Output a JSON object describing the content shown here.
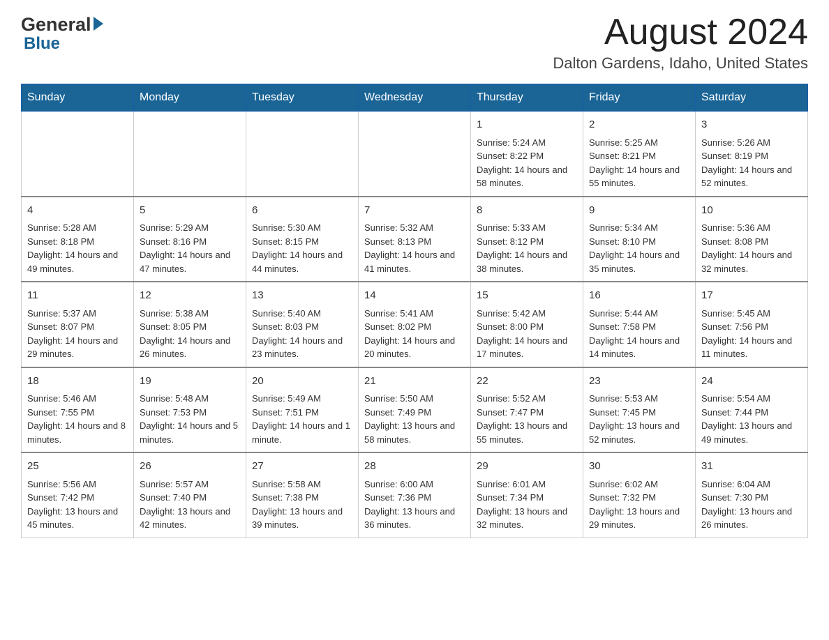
{
  "header": {
    "logo_general": "General",
    "logo_blue": "Blue",
    "month_year": "August 2024",
    "location": "Dalton Gardens, Idaho, United States"
  },
  "days_of_week": [
    "Sunday",
    "Monday",
    "Tuesday",
    "Wednesday",
    "Thursday",
    "Friday",
    "Saturday"
  ],
  "weeks": [
    {
      "cells": [
        {
          "day": "",
          "sunrise": "",
          "sunset": "",
          "daylight": ""
        },
        {
          "day": "",
          "sunrise": "",
          "sunset": "",
          "daylight": ""
        },
        {
          "day": "",
          "sunrise": "",
          "sunset": "",
          "daylight": ""
        },
        {
          "day": "",
          "sunrise": "",
          "sunset": "",
          "daylight": ""
        },
        {
          "day": "1",
          "sunrise": "Sunrise: 5:24 AM",
          "sunset": "Sunset: 8:22 PM",
          "daylight": "Daylight: 14 hours and 58 minutes."
        },
        {
          "day": "2",
          "sunrise": "Sunrise: 5:25 AM",
          "sunset": "Sunset: 8:21 PM",
          "daylight": "Daylight: 14 hours and 55 minutes."
        },
        {
          "day": "3",
          "sunrise": "Sunrise: 5:26 AM",
          "sunset": "Sunset: 8:19 PM",
          "daylight": "Daylight: 14 hours and 52 minutes."
        }
      ]
    },
    {
      "cells": [
        {
          "day": "4",
          "sunrise": "Sunrise: 5:28 AM",
          "sunset": "Sunset: 8:18 PM",
          "daylight": "Daylight: 14 hours and 49 minutes."
        },
        {
          "day": "5",
          "sunrise": "Sunrise: 5:29 AM",
          "sunset": "Sunset: 8:16 PM",
          "daylight": "Daylight: 14 hours and 47 minutes."
        },
        {
          "day": "6",
          "sunrise": "Sunrise: 5:30 AM",
          "sunset": "Sunset: 8:15 PM",
          "daylight": "Daylight: 14 hours and 44 minutes."
        },
        {
          "day": "7",
          "sunrise": "Sunrise: 5:32 AM",
          "sunset": "Sunset: 8:13 PM",
          "daylight": "Daylight: 14 hours and 41 minutes."
        },
        {
          "day": "8",
          "sunrise": "Sunrise: 5:33 AM",
          "sunset": "Sunset: 8:12 PM",
          "daylight": "Daylight: 14 hours and 38 minutes."
        },
        {
          "day": "9",
          "sunrise": "Sunrise: 5:34 AM",
          "sunset": "Sunset: 8:10 PM",
          "daylight": "Daylight: 14 hours and 35 minutes."
        },
        {
          "day": "10",
          "sunrise": "Sunrise: 5:36 AM",
          "sunset": "Sunset: 8:08 PM",
          "daylight": "Daylight: 14 hours and 32 minutes."
        }
      ]
    },
    {
      "cells": [
        {
          "day": "11",
          "sunrise": "Sunrise: 5:37 AM",
          "sunset": "Sunset: 8:07 PM",
          "daylight": "Daylight: 14 hours and 29 minutes."
        },
        {
          "day": "12",
          "sunrise": "Sunrise: 5:38 AM",
          "sunset": "Sunset: 8:05 PM",
          "daylight": "Daylight: 14 hours and 26 minutes."
        },
        {
          "day": "13",
          "sunrise": "Sunrise: 5:40 AM",
          "sunset": "Sunset: 8:03 PM",
          "daylight": "Daylight: 14 hours and 23 minutes."
        },
        {
          "day": "14",
          "sunrise": "Sunrise: 5:41 AM",
          "sunset": "Sunset: 8:02 PM",
          "daylight": "Daylight: 14 hours and 20 minutes."
        },
        {
          "day": "15",
          "sunrise": "Sunrise: 5:42 AM",
          "sunset": "Sunset: 8:00 PM",
          "daylight": "Daylight: 14 hours and 17 minutes."
        },
        {
          "day": "16",
          "sunrise": "Sunrise: 5:44 AM",
          "sunset": "Sunset: 7:58 PM",
          "daylight": "Daylight: 14 hours and 14 minutes."
        },
        {
          "day": "17",
          "sunrise": "Sunrise: 5:45 AM",
          "sunset": "Sunset: 7:56 PM",
          "daylight": "Daylight: 14 hours and 11 minutes."
        }
      ]
    },
    {
      "cells": [
        {
          "day": "18",
          "sunrise": "Sunrise: 5:46 AM",
          "sunset": "Sunset: 7:55 PM",
          "daylight": "Daylight: 14 hours and 8 minutes."
        },
        {
          "day": "19",
          "sunrise": "Sunrise: 5:48 AM",
          "sunset": "Sunset: 7:53 PM",
          "daylight": "Daylight: 14 hours and 5 minutes."
        },
        {
          "day": "20",
          "sunrise": "Sunrise: 5:49 AM",
          "sunset": "Sunset: 7:51 PM",
          "daylight": "Daylight: 14 hours and 1 minute."
        },
        {
          "day": "21",
          "sunrise": "Sunrise: 5:50 AM",
          "sunset": "Sunset: 7:49 PM",
          "daylight": "Daylight: 13 hours and 58 minutes."
        },
        {
          "day": "22",
          "sunrise": "Sunrise: 5:52 AM",
          "sunset": "Sunset: 7:47 PM",
          "daylight": "Daylight: 13 hours and 55 minutes."
        },
        {
          "day": "23",
          "sunrise": "Sunrise: 5:53 AM",
          "sunset": "Sunset: 7:45 PM",
          "daylight": "Daylight: 13 hours and 52 minutes."
        },
        {
          "day": "24",
          "sunrise": "Sunrise: 5:54 AM",
          "sunset": "Sunset: 7:44 PM",
          "daylight": "Daylight: 13 hours and 49 minutes."
        }
      ]
    },
    {
      "cells": [
        {
          "day": "25",
          "sunrise": "Sunrise: 5:56 AM",
          "sunset": "Sunset: 7:42 PM",
          "daylight": "Daylight: 13 hours and 45 minutes."
        },
        {
          "day": "26",
          "sunrise": "Sunrise: 5:57 AM",
          "sunset": "Sunset: 7:40 PM",
          "daylight": "Daylight: 13 hours and 42 minutes."
        },
        {
          "day": "27",
          "sunrise": "Sunrise: 5:58 AM",
          "sunset": "Sunset: 7:38 PM",
          "daylight": "Daylight: 13 hours and 39 minutes."
        },
        {
          "day": "28",
          "sunrise": "Sunrise: 6:00 AM",
          "sunset": "Sunset: 7:36 PM",
          "daylight": "Daylight: 13 hours and 36 minutes."
        },
        {
          "day": "29",
          "sunrise": "Sunrise: 6:01 AM",
          "sunset": "Sunset: 7:34 PM",
          "daylight": "Daylight: 13 hours and 32 minutes."
        },
        {
          "day": "30",
          "sunrise": "Sunrise: 6:02 AM",
          "sunset": "Sunset: 7:32 PM",
          "daylight": "Daylight: 13 hours and 29 minutes."
        },
        {
          "day": "31",
          "sunrise": "Sunrise: 6:04 AM",
          "sunset": "Sunset: 7:30 PM",
          "daylight": "Daylight: 13 hours and 26 minutes."
        }
      ]
    }
  ]
}
